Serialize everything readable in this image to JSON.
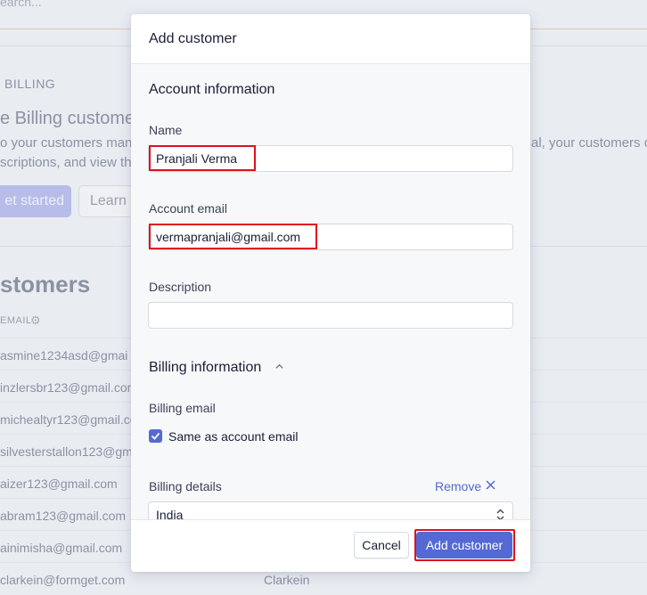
{
  "background": {
    "search_placeholder": "earch...",
    "billing_label": "BILLING",
    "billing_heading": "e Billing customer",
    "description_line1": "o your customers mana",
    "description_line1_right": "al, your customers ca",
    "description_line2": "scriptions, and view the",
    "get_started_label": "et started",
    "learn_label": "Learn",
    "customers_heading": "stomers",
    "email_column": "EMAIL",
    "rows": [
      {
        "email": "asmine1234asd@gmai",
        "name": ""
      },
      {
        "email": "inzlersbr123@gmail.com",
        "name": ""
      },
      {
        "email": "michealtyr123@gmail.co",
        "name": ""
      },
      {
        "email": "silvesterstallon123@gm",
        "name": ""
      },
      {
        "email": "aizer123@gmail.com",
        "name": ""
      },
      {
        "email": "abram123@gmail.com",
        "name": ""
      },
      {
        "email": "ainimisha@gmail.com",
        "name": ""
      },
      {
        "email": "clarkein@formget.com",
        "name": "Clarkein"
      }
    ]
  },
  "modal": {
    "title": "Add customer",
    "account_section": "Account information",
    "name_label": "Name",
    "name_value": "Pranjali Verma",
    "email_label": "Account email",
    "email_value": "vermapranjali@gmail.com",
    "description_label": "Description",
    "description_value": "",
    "billing_section": "Billing information",
    "billing_email_label": "Billing email",
    "same_as_account_label": "Same as account email",
    "same_as_account_checked": true,
    "billing_details_label": "Billing details",
    "remove_label": "Remove",
    "country_value": "India",
    "cancel_label": "Cancel",
    "submit_label": "Add customer"
  },
  "colors": {
    "accent": "#5469d4",
    "highlight": "#e0101e"
  }
}
